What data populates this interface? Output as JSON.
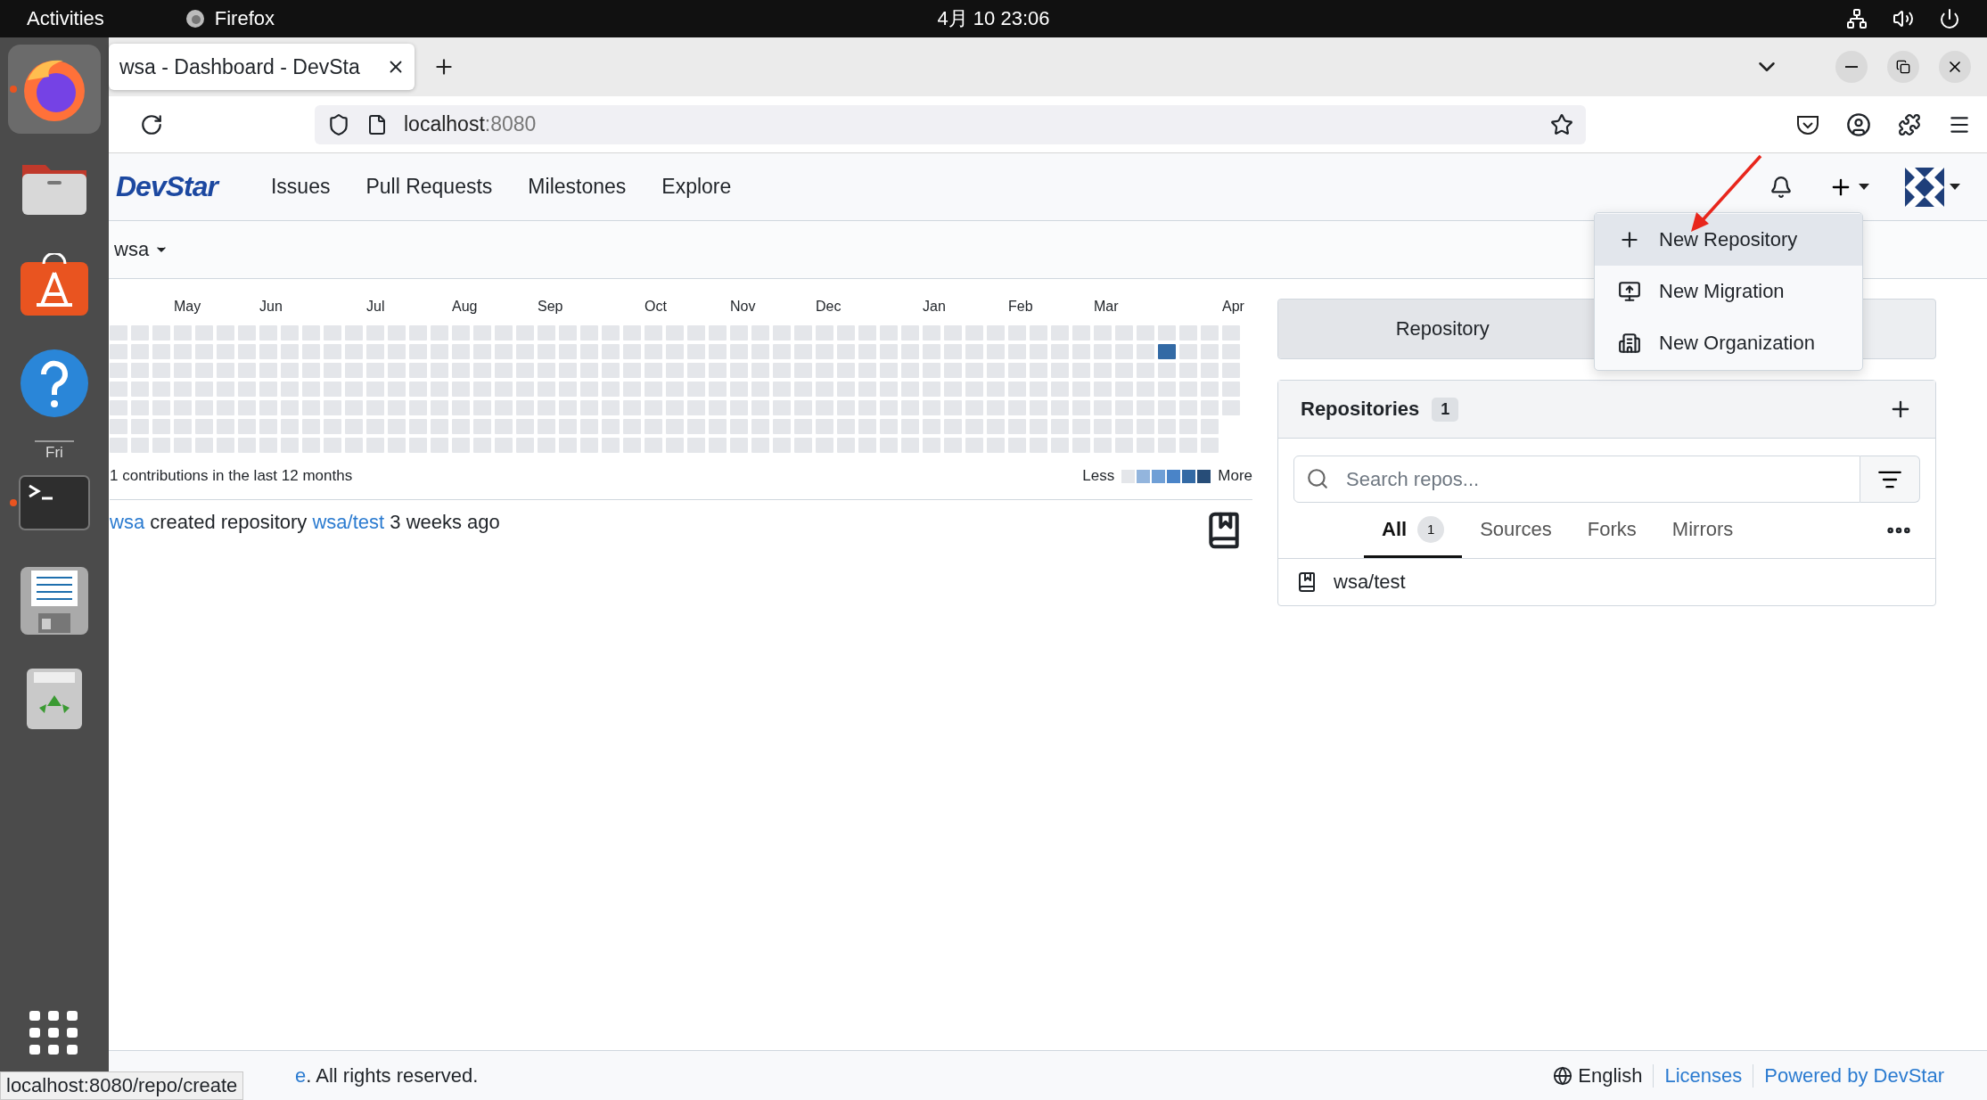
{
  "top_bar": {
    "activities": "Activities",
    "app": "Firefox",
    "clock": "4月 10  23:06"
  },
  "dock": {
    "items": [
      {
        "kind": "firefox",
        "running": true,
        "selected": true
      },
      {
        "kind": "files",
        "running": false,
        "selected": false
      },
      {
        "kind": "appstore",
        "running": false,
        "selected": false
      },
      {
        "kind": "help",
        "running": false,
        "selected": false
      },
      {
        "kind": "terminal",
        "running": true,
        "selected": false
      },
      {
        "kind": "editor",
        "running": false,
        "selected": false
      },
      {
        "kind": "trash",
        "running": false,
        "selected": false
      }
    ],
    "day_label": "Fri"
  },
  "browser": {
    "tab": {
      "title": "wsa - Dashboard - DevSta"
    },
    "url": {
      "host": "localhost",
      "port": ":8080"
    },
    "status_link": "localhost:8080/repo/create"
  },
  "app_header": {
    "logo": "DevStar",
    "nav": [
      "Issues",
      "Pull Requests",
      "Milestones",
      "Explore"
    ]
  },
  "context": {
    "user": "wsa"
  },
  "heatmap": {
    "months": [
      "May",
      "Jun",
      "Jul",
      "Aug",
      "Sep",
      "Oct",
      "Nov",
      "Dec",
      "Jan",
      "Feb",
      "Mar",
      "Apr"
    ],
    "summary": "1 contributions in the last 12 months",
    "legend": {
      "less": "Less",
      "more": "More"
    }
  },
  "activity": [
    {
      "user": "wsa",
      "action": "created repository",
      "repo": "wsa/test",
      "time": "3 weeks ago"
    }
  ],
  "panel": {
    "tab": "Repository",
    "repositories": {
      "title": "Repositories",
      "count": "1",
      "search_placeholder": "Search repos...",
      "filters": [
        {
          "label": "All",
          "count": "1",
          "selected": true
        },
        {
          "label": "Sources",
          "selected": false
        },
        {
          "label": "Forks",
          "selected": false
        },
        {
          "label": "Mirrors",
          "selected": false
        }
      ],
      "items": [
        "wsa/test"
      ]
    }
  },
  "create_menu": {
    "items": [
      {
        "kind": "repository",
        "label": "New Repository",
        "highlighted": true
      },
      {
        "kind": "migration",
        "label": "New Migration",
        "highlighted": false
      },
      {
        "kind": "organization",
        "label": "New Organization",
        "highlighted": false
      }
    ]
  },
  "footer": {
    "link": "e",
    "text": ". All rights reserved.",
    "language": "English",
    "links": [
      "Licenses",
      "Powered by DevStar"
    ]
  }
}
